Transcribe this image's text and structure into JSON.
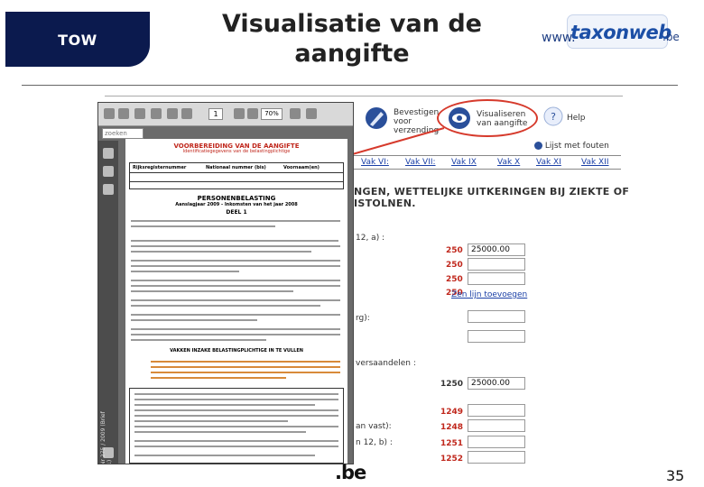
{
  "header": {
    "tab_label": "TOW",
    "title_line1": "Visualisatie van de",
    "title_line2": "aangifte",
    "logo": {
      "prefix": "www.",
      "word": "taxonweb",
      "suffix": ".be"
    }
  },
  "app_toolbar": {
    "confirm_label_1": "Bevestigen",
    "confirm_label_2": "voor",
    "confirm_label_3": "verzending",
    "visualize_label_1": "Visualiseren",
    "visualize_label_2": "van aangifte",
    "help_label": "Help",
    "error_list_label": "Lijst met fouten"
  },
  "app_tabs": [
    "Vak VI:",
    "Vak VII:",
    "Vak IX",
    "Vak X",
    "Vak XI",
    "Vak XII"
  ],
  "app_section_heading_1": "NGEN, WETTELIJKE UITKERINGEN BIJ ZIEKTE OF",
  "app_section_heading_2": "ISTOLNEN.",
  "app_rows": [
    {
      "label": "12, a) :",
      "code": "250",
      "value": "25000.00"
    },
    {
      "label": "",
      "code": "250",
      "value": ""
    },
    {
      "label": "",
      "code": "250",
      "value": ""
    },
    {
      "label": "",
      "code": "250",
      "value": ""
    },
    {
      "label": "rg):",
      "code": "",
      "value": ""
    },
    {
      "label": "versaandelen :",
      "code": "1250",
      "value": "25000.00"
    },
    {
      "label": "",
      "code": "1249",
      "value": ""
    },
    {
      "label": "an vast):",
      "code": "1248",
      "value": ""
    },
    {
      "label": "n 12, b) :",
      "code": "1251",
      "value": ""
    },
    {
      "label": "",
      "code": "1252",
      "value": ""
    }
  ],
  "app_add_link": "Zen lijn toevoegen",
  "pdf_viewer": {
    "page_number": "1",
    "zoom": "70%",
    "search_placeholder": "zoeken",
    "sidebar_text": "Nr 275 / 2009 (Brief 1)",
    "doc_title": "VOORBEREIDING VAN DE AANGIFTE",
    "doc_subtitle": "Identificatiegegevens van de belastingplichtige",
    "grid_col1": "Rijksregisternummer",
    "grid_col2": "Nationaal nummer (bis)",
    "grid_col3": "Voornaam(en)",
    "heading_main": "PERSONENBELASTING",
    "heading_sub": "Aanslagjaar 2009 - Inkomsten van het jaar 2008",
    "heading_part": "DEEL 1",
    "heading_vakken": "VAKKEN INZAKE BELASTINGPLICHTIGE IN TE VULLEN"
  },
  "footer": {
    "brand": ".be",
    "page_number": "35"
  },
  "colors": {
    "navy": "#0b1a4e",
    "red": "#c0271c",
    "link": "#1a3fa6"
  }
}
